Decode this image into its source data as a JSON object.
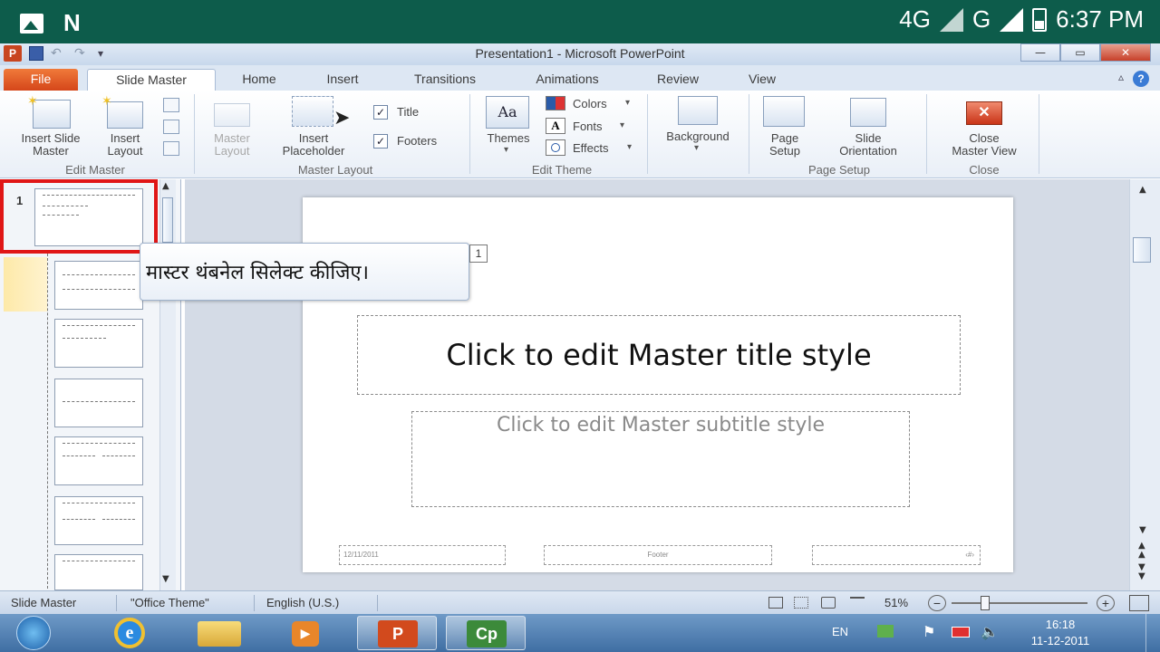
{
  "status_bar": {
    "network1": "4G",
    "network2": "G",
    "time": "6:37 PM"
  },
  "window": {
    "title": "Presentation1  -  Microsoft PowerPoint"
  },
  "tabs": [
    "File",
    "Slide Master",
    "Home",
    "Insert",
    "Transitions",
    "Animations",
    "Review",
    "View"
  ],
  "ribbon": {
    "insert_slide_master": "Insert Slide\nMaster",
    "insert_layout": "Insert\nLayout",
    "edit_master_group": "Edit Master",
    "master_layout_btn": "Master\nLayout",
    "insert_placeholder": "Insert\nPlaceholder",
    "title_check": "Title",
    "footers_check": "Footers",
    "master_layout_group": "Master Layout",
    "themes": "Themes",
    "colors": "Colors",
    "fonts": "Fonts",
    "effects": "Effects",
    "edit_theme_group": "Edit Theme",
    "background": "Background",
    "page_setup": "Page\nSetup",
    "slide_orientation": "Slide\nOrientation",
    "page_setup_group": "Page Setup",
    "close_master_view": "Close\nMaster View",
    "close_group": "Close"
  },
  "thumbnails": {
    "selected_number": "1"
  },
  "tooltip": {
    "text": "मास्टर थंबनेल सिलेक्ट कीजिए।",
    "badge": "1"
  },
  "slide": {
    "title": "Click to edit Master title style",
    "subtitle": "Click to edit Master subtitle style",
    "date": "12/11/2011",
    "footer": "Footer",
    "number": "‹#›"
  },
  "app_status": {
    "view": "Slide Master",
    "theme": "\"Office Theme\"",
    "language": "English (U.S.)",
    "zoom": "51%"
  },
  "taskbar": {
    "lang": "EN",
    "time": "16:18",
    "date": "11-12-2011",
    "cp_label": "Cp"
  }
}
